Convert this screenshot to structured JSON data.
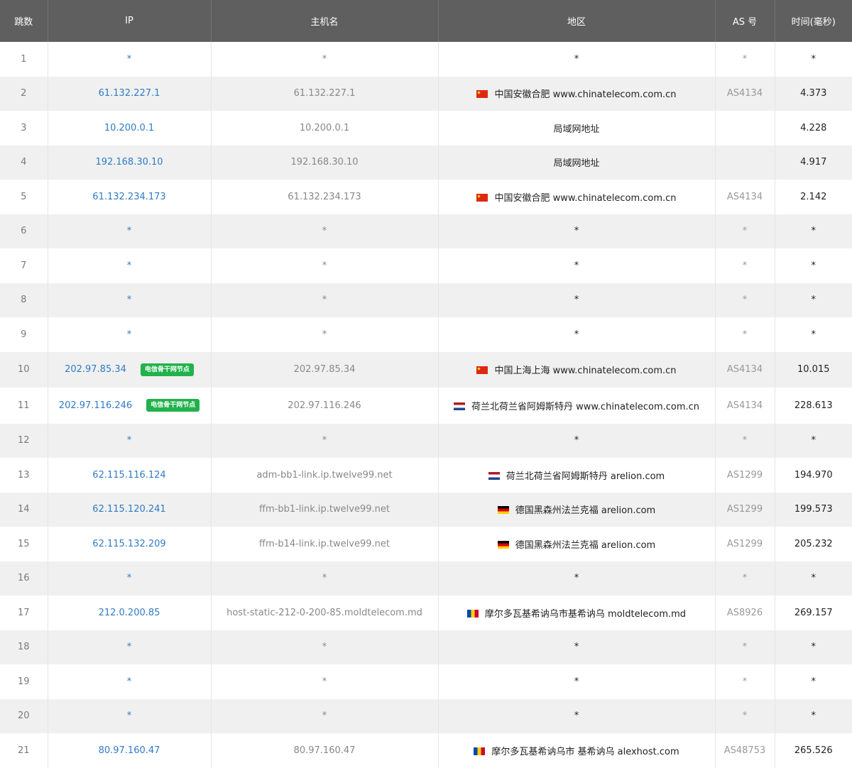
{
  "headers": {
    "hop": "跳数",
    "ip": "IP",
    "hostname": "主机名",
    "region": "地区",
    "as": "AS 号",
    "time": "时间(毫秒)"
  },
  "badge_label": "电信骨干网节点",
  "flags": {
    "cn": {
      "name": "china-flag-icon",
      "colors": [
        "#de2910",
        "#ffde00"
      ]
    },
    "nl": {
      "name": "netherlands-flag-icon",
      "colors": [
        "#ae1c28",
        "#ffffff",
        "#21468b"
      ]
    },
    "de": {
      "name": "germany-flag-icon",
      "colors": [
        "#000000",
        "#dd0000",
        "#ffce00"
      ]
    },
    "md": {
      "name": "moldova-flag-icon",
      "colors": [
        "#0046ae",
        "#ffd200",
        "#cc092f"
      ]
    }
  },
  "rows": [
    {
      "hop": "1",
      "ip": "*",
      "host": "*",
      "flag": "",
      "region": "*",
      "as": "*",
      "time": "*",
      "badge": false
    },
    {
      "hop": "2",
      "ip": "61.132.227.1",
      "host": "61.132.227.1",
      "flag": "cn",
      "region": "中国安徽合肥 www.chinatelecom.com.cn",
      "as": "AS4134",
      "time": "4.373",
      "badge": false
    },
    {
      "hop": "3",
      "ip": "10.200.0.1",
      "host": "10.200.0.1",
      "flag": "",
      "region": "局域网地址",
      "as": "",
      "time": "4.228",
      "badge": false
    },
    {
      "hop": "4",
      "ip": "192.168.30.10",
      "host": "192.168.30.10",
      "flag": "",
      "region": "局域网地址",
      "as": "",
      "time": "4.917",
      "badge": false
    },
    {
      "hop": "5",
      "ip": "61.132.234.173",
      "host": "61.132.234.173",
      "flag": "cn",
      "region": "中国安徽合肥 www.chinatelecom.com.cn",
      "as": "AS4134",
      "time": "2.142",
      "badge": false
    },
    {
      "hop": "6",
      "ip": "*",
      "host": "*",
      "flag": "",
      "region": "*",
      "as": "*",
      "time": "*",
      "badge": false
    },
    {
      "hop": "7",
      "ip": "*",
      "host": "*",
      "flag": "",
      "region": "*",
      "as": "*",
      "time": "*",
      "badge": false
    },
    {
      "hop": "8",
      "ip": "*",
      "host": "*",
      "flag": "",
      "region": "*",
      "as": "*",
      "time": "*",
      "badge": false
    },
    {
      "hop": "9",
      "ip": "*",
      "host": "*",
      "flag": "",
      "region": "*",
      "as": "*",
      "time": "*",
      "badge": false
    },
    {
      "hop": "10",
      "ip": "202.97.85.34",
      "host": "202.97.85.34",
      "flag": "cn",
      "region": "中国上海上海 www.chinatelecom.com.cn",
      "as": "AS4134",
      "time": "10.015",
      "badge": true
    },
    {
      "hop": "11",
      "ip": "202.97.116.246",
      "host": "202.97.116.246",
      "flag": "nl",
      "region": "荷兰北荷兰省阿姆斯特丹 www.chinatelecom.com.cn",
      "as": "AS4134",
      "time": "228.613",
      "badge": true
    },
    {
      "hop": "12",
      "ip": "*",
      "host": "*",
      "flag": "",
      "region": "*",
      "as": "*",
      "time": "*",
      "badge": false
    },
    {
      "hop": "13",
      "ip": "62.115.116.124",
      "host": "adm-bb1-link.ip.twelve99.net",
      "flag": "nl",
      "region": "荷兰北荷兰省阿姆斯特丹 arelion.com",
      "as": "AS1299",
      "time": "194.970",
      "badge": false
    },
    {
      "hop": "14",
      "ip": "62.115.120.241",
      "host": "ffm-bb1-link.ip.twelve99.net",
      "flag": "de",
      "region": "德国黑森州法兰克福 arelion.com",
      "as": "AS1299",
      "time": "199.573",
      "badge": false
    },
    {
      "hop": "15",
      "ip": "62.115.132.209",
      "host": "ffm-b14-link.ip.twelve99.net",
      "flag": "de",
      "region": "德国黑森州法兰克福 arelion.com",
      "as": "AS1299",
      "time": "205.232",
      "badge": false
    },
    {
      "hop": "16",
      "ip": "*",
      "host": "*",
      "flag": "",
      "region": "*",
      "as": "*",
      "time": "*",
      "badge": false
    },
    {
      "hop": "17",
      "ip": "212.0.200.85",
      "host": "host-static-212-0-200-85.moldtelecom.md",
      "flag": "md",
      "region": "摩尔多瓦基希讷乌市基希讷乌 moldtelecom.md",
      "as": "AS8926",
      "time": "269.157",
      "badge": false
    },
    {
      "hop": "18",
      "ip": "*",
      "host": "*",
      "flag": "",
      "region": "*",
      "as": "*",
      "time": "*",
      "badge": false
    },
    {
      "hop": "19",
      "ip": "*",
      "host": "*",
      "flag": "",
      "region": "*",
      "as": "*",
      "time": "*",
      "badge": false
    },
    {
      "hop": "20",
      "ip": "*",
      "host": "*",
      "flag": "",
      "region": "*",
      "as": "*",
      "time": "*",
      "badge": false
    },
    {
      "hop": "21",
      "ip": "80.97.160.47",
      "host": "80.97.160.47",
      "flag": "md",
      "region": "摩尔多瓦基希讷乌市 基希讷乌 alexhost.com",
      "as": "AS48753",
      "time": "265.526",
      "badge": false
    }
  ]
}
